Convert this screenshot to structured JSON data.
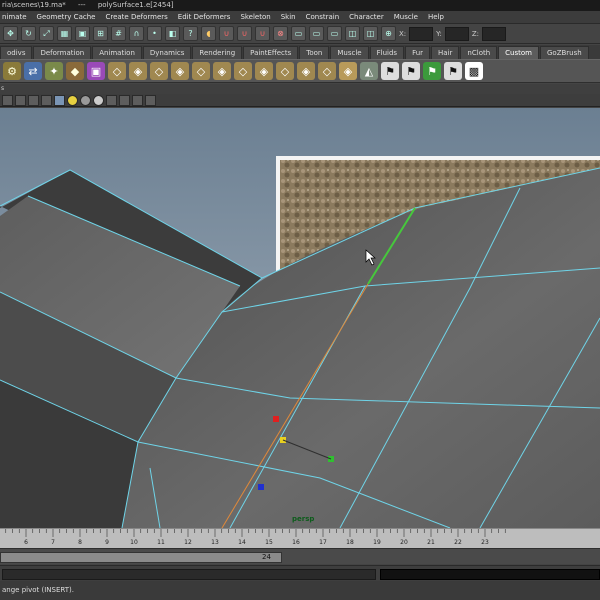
{
  "titlebar": {
    "scene_path": "ria\\scenes\\19.ma*",
    "separator": "---",
    "selection": "polySurface1.e[2454]"
  },
  "menubar": {
    "items": [
      "nimate",
      "Geometry Cache",
      "Create Deformers",
      "Edit Deformers",
      "Skeleton",
      "Skin",
      "Constrain",
      "Character",
      "Muscle",
      "Help"
    ]
  },
  "statusline": {
    "x_label": "X:",
    "y_label": "Y:",
    "z_label": "Z:"
  },
  "shelf": {
    "tabs": [
      "odivs",
      "Deformation",
      "Animation",
      "Dynamics",
      "Rendering",
      "PaintEffects",
      "Toon",
      "Muscle",
      "Fluids",
      "Fur",
      "Hair",
      "nCloth",
      "Custom",
      "GoZBrush"
    ],
    "active_tab": "Custom"
  },
  "panel": {
    "menu_fragment": "s"
  },
  "viewport": {
    "camera": "persp",
    "colors": {
      "background_top": "#6b7f92",
      "background_bottom": "#a9b5c0",
      "mesh": "#5a5a5a",
      "wire": "#6fd4e8",
      "selected_edge": "#46c83c",
      "manip_line": "#e0893a"
    }
  },
  "timeslider": {
    "ticks": [
      "6",
      "7",
      "8",
      "9",
      "10",
      "11",
      "12",
      "13",
      "14",
      "15",
      "16",
      "17",
      "18",
      "19",
      "20",
      "21",
      "22",
      "23"
    ]
  },
  "rangeslider": {
    "end_value": "24"
  },
  "helpline": {
    "text": "ange pivot (INSERT)."
  }
}
